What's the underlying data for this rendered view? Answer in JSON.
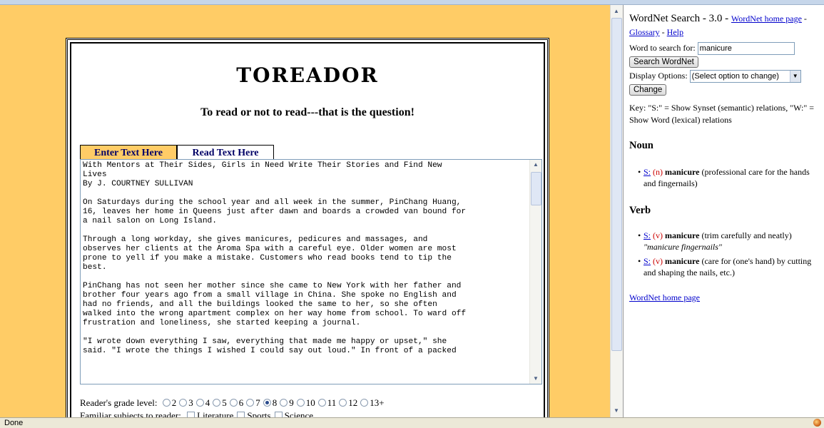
{
  "left": {
    "title": "TOREADOR",
    "subtitle": "To read or not to read---that is the question!",
    "tabs": [
      {
        "label": "Enter Text Here",
        "active": true
      },
      {
        "label": "Read Text Here",
        "active": false
      }
    ],
    "text_body": "With Mentors at Their Sides, Girls in Need Write Their Stories and Find New\nLives\nBy J. COURTNEY SULLIVAN\n\nOn Saturdays during the school year and all week in the summer, PinChang Huang,\n16, leaves her home in Queens just after dawn and boards a crowded van bound for\na nail salon on Long Island.\n\nThrough a long workday, she gives manicures, pedicures and massages, and\nobserves her clients at the Aroma Spa with a careful eye. Older women are most\nprone to yell if you make a mistake. Customers who read books tend to tip the\nbest.\n\nPinChang has not seen her mother since she came to New York with her father and\nbrother four years ago from a small village in China. She spoke no English and\nhad no friends, and all the buildings looked the same to her, so she often\nwalked into the wrong apartment complex on her way home from school. To ward off\nfrustration and loneliness, she started keeping a journal.\n\n\"I wrote down everything I saw, everything that made me happy or upset,\" she\nsaid. \"I wrote the things I wished I could say out loud.\" In front of a packed",
    "grade_label": "Reader's grade level:",
    "grades": [
      "2",
      "3",
      "4",
      "5",
      "6",
      "7",
      "8",
      "9",
      "10",
      "11",
      "12",
      "13+"
    ],
    "grade_selected": "8",
    "subjects_label": "Familiar subjects to reader:",
    "subjects": [
      "Literature",
      "Sports",
      "Science"
    ]
  },
  "wordnet": {
    "title": "WordNet Search",
    "version_sep": " - 3.0 - ",
    "home_link": "WordNet home page",
    "sep": " - ",
    "glossary_link": "Glossary",
    "help_link": "Help",
    "word_label": "Word to search for:",
    "word_value": "manicure",
    "search_button": "Search WordNet",
    "display_label": "Display Options:",
    "display_value": "(Select option to change)",
    "change_button": "Change",
    "key_text": "Key: \"S:\" = Show Synset (semantic) relations, \"W:\" = Show Word (lexical) relations",
    "noun_heading": "Noun",
    "noun_senses": [
      {
        "s": "S:",
        "pos": "(n)",
        "word": "manicure",
        "gloss": "(professional care for the hands and fingernails)",
        "example": ""
      }
    ],
    "verb_heading": "Verb",
    "verb_senses": [
      {
        "s": "S:",
        "pos": "(v)",
        "word": "manicure",
        "gloss": "(trim carefully and neatly)",
        "example": "\"manicure fingernails\""
      },
      {
        "s": "S:",
        "pos": "(v)",
        "word": "manicure",
        "gloss": "(care for (one's hand) by cutting and shaping the nails, etc.)",
        "example": ""
      }
    ],
    "footer_link": "WordNet home page"
  },
  "status": {
    "text": "Done"
  }
}
